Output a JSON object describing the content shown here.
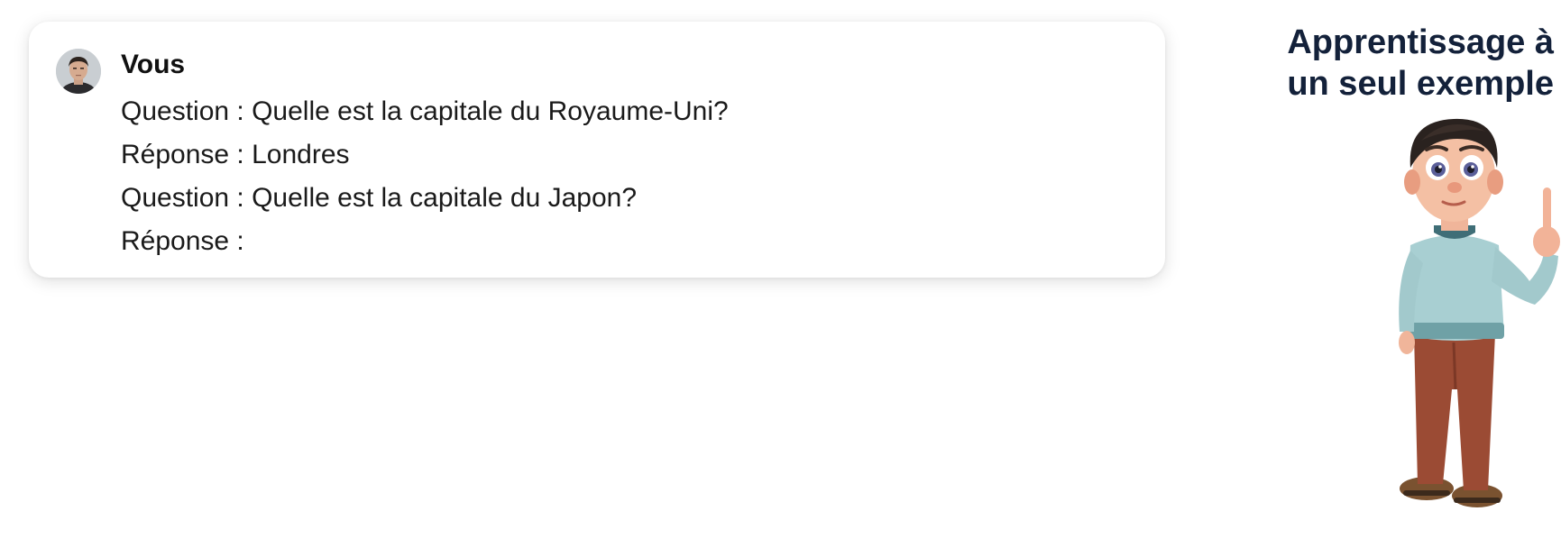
{
  "chat": {
    "sender": "Vous",
    "lines": [
      "Question : Quelle est la capitale du Royaume-Uni?",
      "Réponse : Londres",
      "Question : Quelle est la capitale du Japon?",
      "Réponse :"
    ]
  },
  "side_panel": {
    "title_line1": "Apprentissage à",
    "title_line2": "un seul exemple"
  },
  "icons": [
    "user-avatar",
    "character-illustration"
  ],
  "colors": {
    "title": "#13213a",
    "text": "#1a1a1a",
    "card_background": "#ffffff"
  }
}
